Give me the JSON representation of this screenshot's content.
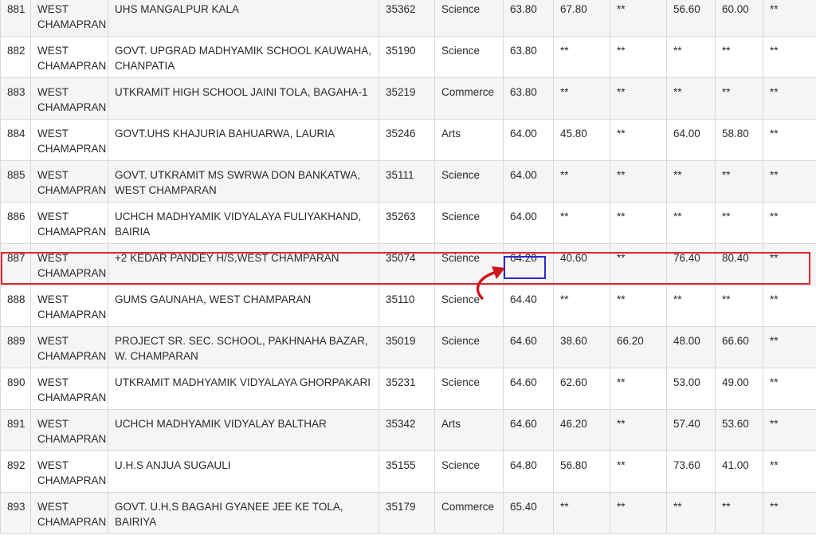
{
  "rows": [
    {
      "rank": "881",
      "district": "WEST CHAMAPRAN",
      "school": "UHS MANGALPUR KALA",
      "code": "35362",
      "stream": "Science",
      "m1": "63.80",
      "m2": "67.80",
      "m3": "**",
      "m4": "56.60",
      "m5": "60.00",
      "m6": "**"
    },
    {
      "rank": "882",
      "district": "WEST CHAMAPRAN",
      "school": "GOVT. UPGRAD MADHYAMIK SCHOOL KAUWAHA, CHANPATIA",
      "code": "35190",
      "stream": "Science",
      "m1": "63.80",
      "m2": "**",
      "m3": "**",
      "m4": "**",
      "m5": "**",
      "m6": "**"
    },
    {
      "rank": "883",
      "district": "WEST CHAMAPRAN",
      "school": "UTKRAMIT HIGH SCHOOL JAINI TOLA, BAGAHA-1",
      "code": "35219",
      "stream": "Commerce",
      "m1": "63.80",
      "m2": "**",
      "m3": "**",
      "m4": "**",
      "m5": "**",
      "m6": "**"
    },
    {
      "rank": "884",
      "district": "WEST CHAMAPRAN",
      "school": "GOVT.UHS KHAJURIA BAHUARWA, LAURIA",
      "code": "35246",
      "stream": "Arts",
      "m1": "64.00",
      "m2": "45.80",
      "m3": "**",
      "m4": "64.00",
      "m5": "58.80",
      "m6": "**"
    },
    {
      "rank": "885",
      "district": "WEST CHAMAPRAN",
      "school": "GOVT. UTKRAMIT MS SWRWA DON BANKATWA, WEST CHAMPARAN",
      "code": "35111",
      "stream": "Science",
      "m1": "64.00",
      "m2": "**",
      "m3": "**",
      "m4": "**",
      "m5": "**",
      "m6": "**"
    },
    {
      "rank": "886",
      "district": "WEST CHAMAPRAN",
      "school": "UCHCH MADHYAMIK VIDYALAYA FULIYAKHAND, BAIRIA",
      "code": "35263",
      "stream": "Science",
      "m1": "64.00",
      "m2": "**",
      "m3": "**",
      "m4": "**",
      "m5": "**",
      "m6": "**"
    },
    {
      "rank": "887",
      "district": "WEST CHAMAPRAN",
      "school": "+2 KEDAR PANDEY H/S,WEST CHAMPARAN",
      "code": "35074",
      "stream": "Science",
      "m1": "64.20",
      "m2": "40.60",
      "m3": "**",
      "m4": "76.40",
      "m5": "80.40",
      "m6": "**"
    },
    {
      "rank": "888",
      "district": "WEST CHAMAPRAN",
      "school": "GUMS GAUNAHA, WEST CHAMPARAN",
      "code": "35110",
      "stream": "Science",
      "m1": "64.40",
      "m2": "**",
      "m3": "**",
      "m4": "**",
      "m5": "**",
      "m6": "**"
    },
    {
      "rank": "889",
      "district": "WEST CHAMAPRAN",
      "school": "PROJECT SR. SEC. SCHOOL, PAKHNAHA BAZAR, W. CHAMPARAN",
      "code": "35019",
      "stream": "Science",
      "m1": "64.60",
      "m2": "38.60",
      "m3": "66.20",
      "m4": "48.00",
      "m5": "66.60",
      "m6": "**"
    },
    {
      "rank": "890",
      "district": "WEST CHAMAPRAN",
      "school": "UTKRAMIT MADHYAMIK VIDYALAYA GHORPAKARI",
      "code": "35231",
      "stream": "Science",
      "m1": "64.60",
      "m2": "62.60",
      "m3": "**",
      "m4": "53.00",
      "m5": "49.00",
      "m6": "**"
    },
    {
      "rank": "891",
      "district": "WEST CHAMAPRAN",
      "school": "UCHCH MADHYAMIK VIDYALAY BALTHAR",
      "code": "35342",
      "stream": "Arts",
      "m1": "64.60",
      "m2": "46.20",
      "m3": "**",
      "m4": "57.40",
      "m5": "53.60",
      "m6": "**"
    },
    {
      "rank": "892",
      "district": "WEST CHAMAPRAN",
      "school": "U.H.S ANJUA SUGAULI",
      "code": "35155",
      "stream": "Science",
      "m1": "64.80",
      "m2": "56.80",
      "m3": "**",
      "m4": "73.60",
      "m5": "41.00",
      "m6": "**"
    },
    {
      "rank": "893",
      "district": "WEST CHAMAPRAN",
      "school": "GOVT. U.H.S BAGAHI GYANEE JEE KE TOLA, BAIRIYA",
      "code": "35179",
      "stream": "Commerce",
      "m1": "65.40",
      "m2": "**",
      "m3": "**",
      "m4": "**",
      "m5": "**",
      "m6": "**"
    }
  ],
  "highlight": {
    "row_rank": "887",
    "cell_value": "64.20",
    "row_border_color": "#e0262d",
    "cell_border_color": "#2a2ad0",
    "arrow_color": "#d0141c",
    "arrow_icon": "curved-arrow-icon"
  }
}
